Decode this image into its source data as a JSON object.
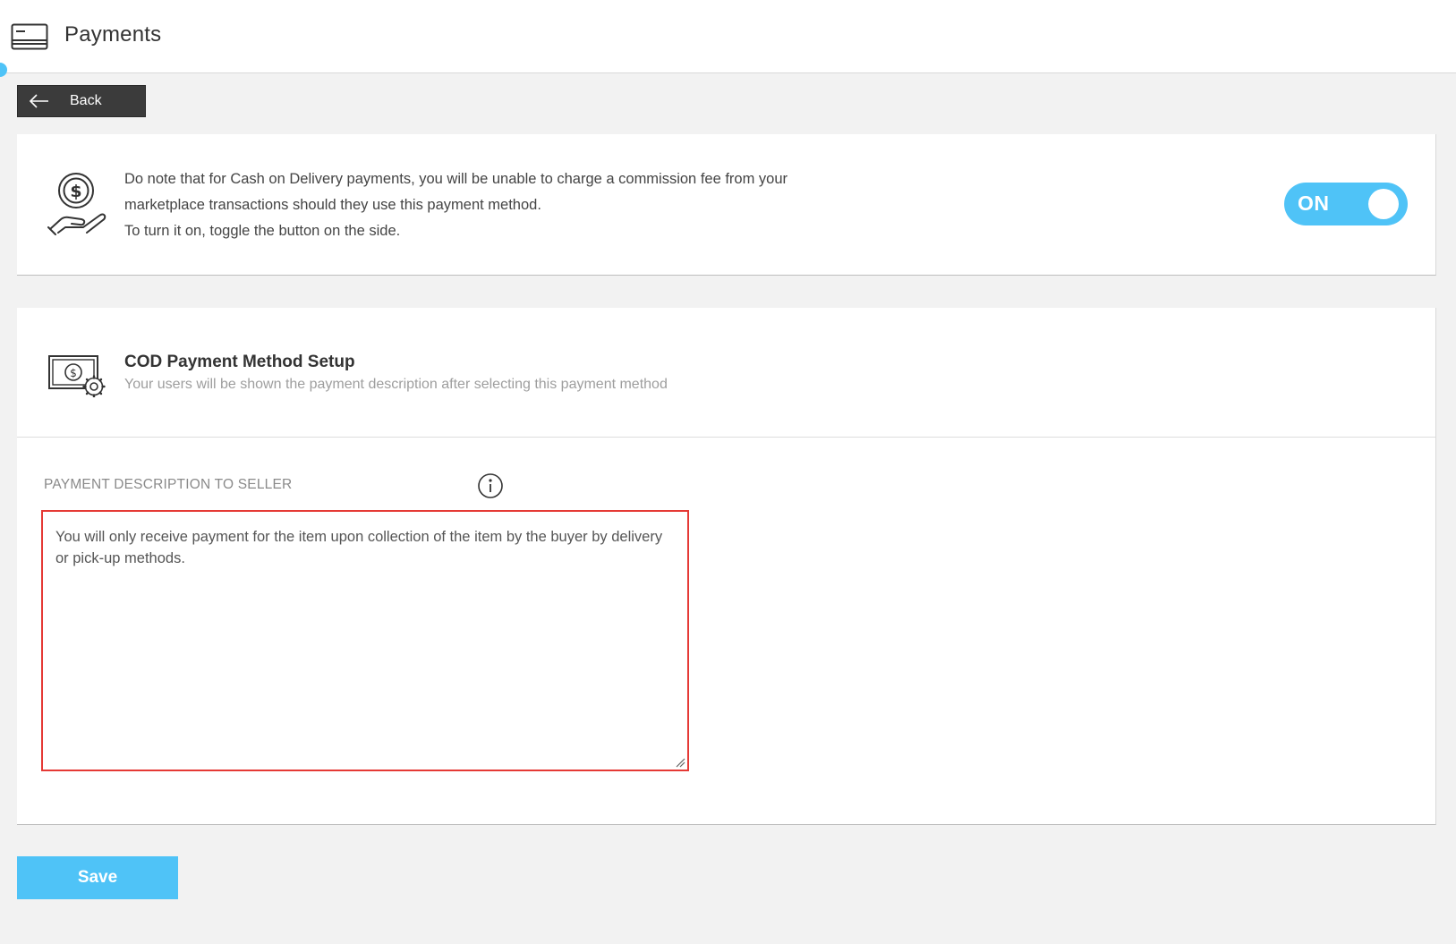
{
  "header": {
    "title": "Payments",
    "icon": "credit-card-icon"
  },
  "back_button": {
    "label": "Back",
    "icon": "arrow-left-icon"
  },
  "cod_notice": {
    "icon": "hand-coin-icon",
    "line1": "Do note that for Cash on Delivery payments, you will be unable to charge a commission fee from your",
    "line2": "marketplace transactions should they use this payment method.",
    "line3": "To turn it on, toggle the button on the side.",
    "toggle": {
      "state_label": "ON",
      "enabled": true,
      "color": "#4fc3f7"
    }
  },
  "setup": {
    "icon": "cash-settings-icon",
    "title": "COD Payment Method Setup",
    "subtitle": "Your users will be shown the payment description after selecting this payment method",
    "field_label": "PAYMENT DESCRIPTION TO SELLER",
    "info_icon": "info-icon",
    "description_value": "You will only receive payment for the item upon collection of the item by the buyer by delivery or pick-up methods.",
    "highlight_color": "#e53935"
  },
  "save_button": {
    "label": "Save",
    "color": "#4fc3f7"
  }
}
